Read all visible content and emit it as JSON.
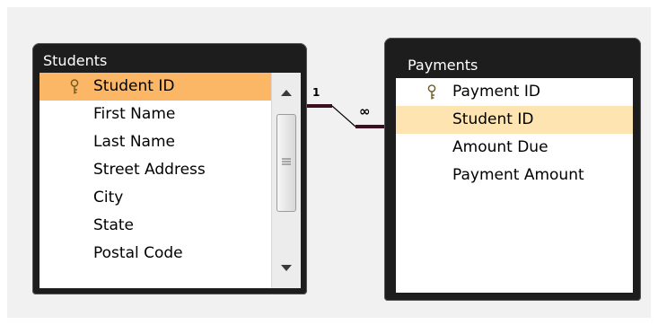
{
  "tables": {
    "students": {
      "title": "Students",
      "fields": [
        {
          "label": "Student ID",
          "key": true,
          "state": "selected"
        },
        {
          "label": "First Name"
        },
        {
          "label": "Last Name"
        },
        {
          "label": "Street Address"
        },
        {
          "label": "City"
        },
        {
          "label": "State"
        },
        {
          "label": "Postal Code"
        }
      ]
    },
    "payments": {
      "title": "Payments",
      "fields": [
        {
          "label": "Payment ID",
          "key": true
        },
        {
          "label": "Student ID",
          "state": "highlighted"
        },
        {
          "label": "Amount Due"
        },
        {
          "label": "Payment Amount"
        }
      ]
    }
  },
  "relationship": {
    "one_side": "1",
    "many_side": "∞"
  },
  "colors": {
    "selected_row": "#fbb766",
    "highlighted_row": "#fde4b0",
    "table_frame": "#1d1d1d",
    "relationship_line": "#3a0f22"
  },
  "icons": {
    "primary_key": "key-icon",
    "scroll_up": "triangle-up-icon",
    "scroll_down": "triangle-down-icon"
  }
}
